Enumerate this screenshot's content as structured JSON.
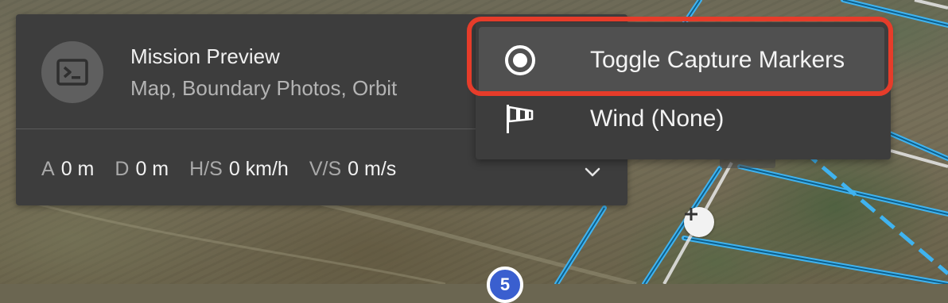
{
  "panel": {
    "title": "Mission Preview",
    "subtitle": "Map, Boundary Photos, Orbit",
    "icon": "terminal-icon",
    "expand_icon": "chevron-down-icon",
    "stats": [
      {
        "label": "A",
        "value": "0 m"
      },
      {
        "label": "D",
        "value": "0 m"
      },
      {
        "label": "H/S",
        "value": "0 km/h"
      },
      {
        "label": "V/S",
        "value": "0 m/s"
      }
    ]
  },
  "menu": {
    "items": [
      {
        "label": "Toggle Capture Markers",
        "icon": "radio-target-icon"
      },
      {
        "label": "Wind (None)",
        "icon": "windsock-icon"
      }
    ]
  },
  "map": {
    "add_waypoint_icon": "plus-icon",
    "waypoint_label": "5"
  },
  "colors": {
    "panel_bg": "#3d3d3d",
    "highlight_bg": "#505050",
    "callout": "#e63c2a",
    "flight_path": "#3fb3f0"
  }
}
